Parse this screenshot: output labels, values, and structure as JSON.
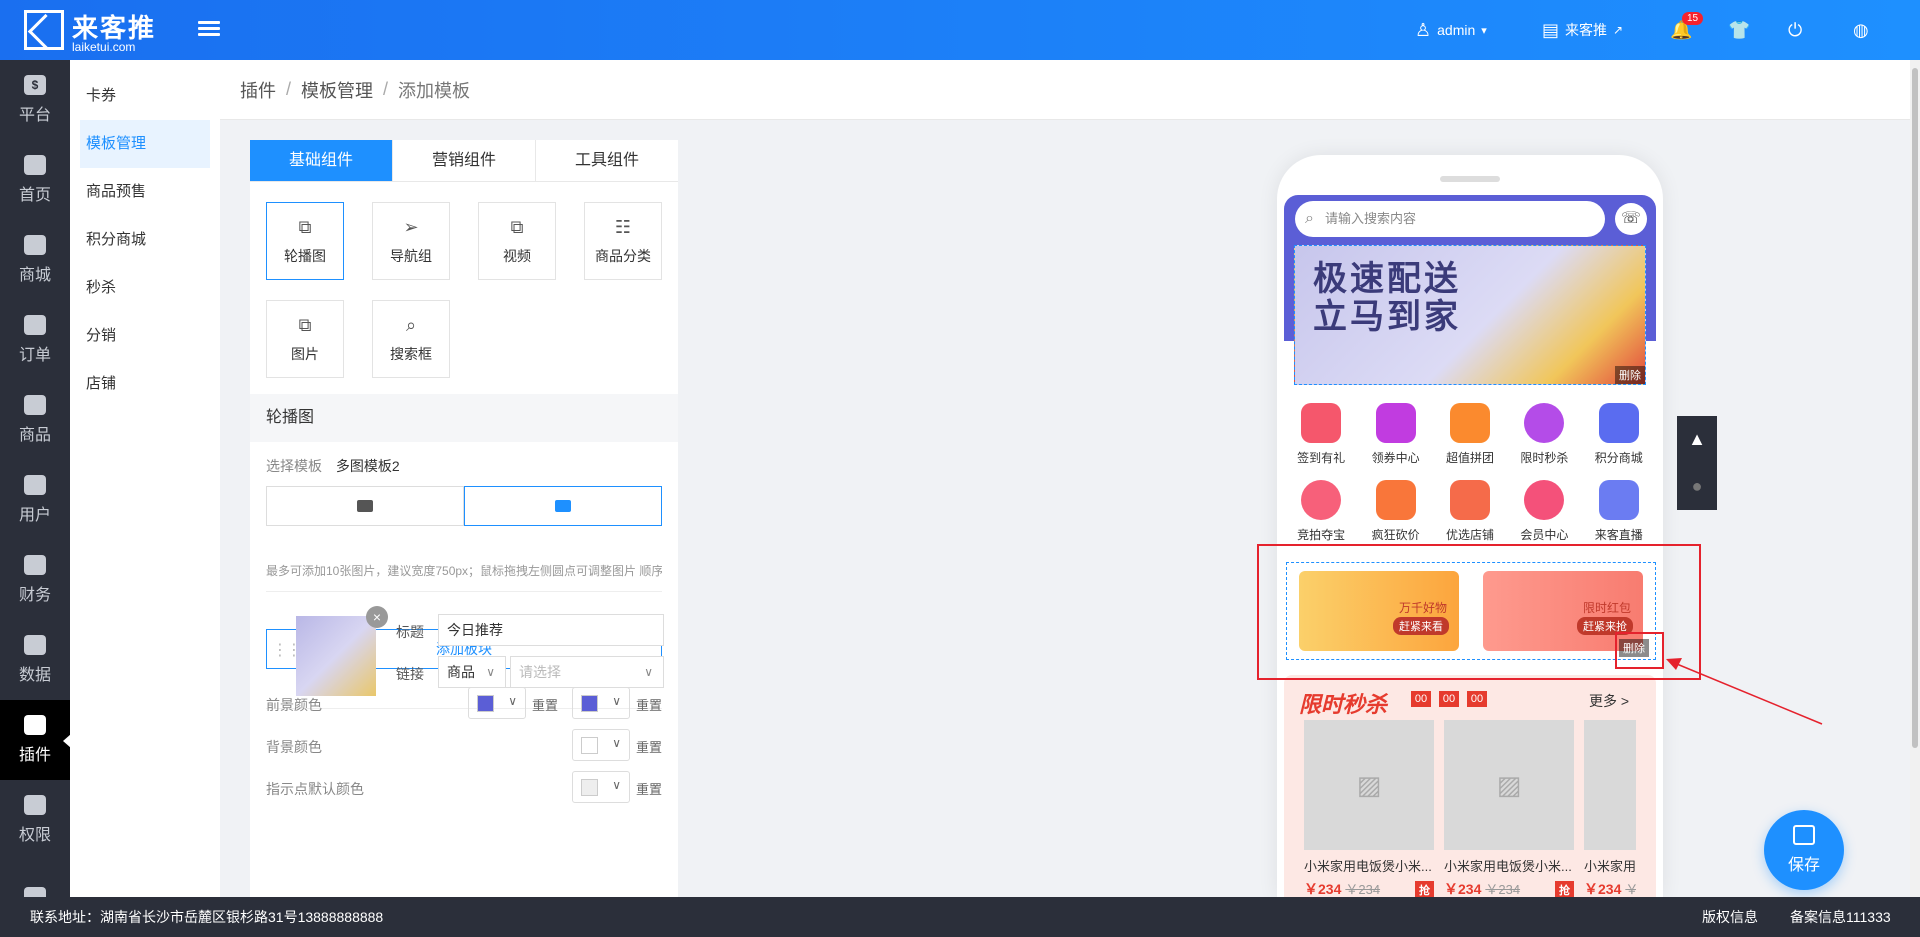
{
  "header": {
    "logo_cn": "来客推",
    "logo_en": "laiketui.com",
    "user": "admin",
    "shop": "来客推",
    "notifications": "15"
  },
  "nav": {
    "items": [
      {
        "label": "平台",
        "icon": "platform-icon"
      },
      {
        "label": "首页",
        "icon": "home-icon"
      },
      {
        "label": "商城",
        "icon": "mall-icon"
      },
      {
        "label": "订单",
        "icon": "order-icon"
      },
      {
        "label": "商品",
        "icon": "goods-icon"
      },
      {
        "label": "用户",
        "icon": "user-icon"
      },
      {
        "label": "财务",
        "icon": "wallet-icon"
      },
      {
        "label": "数据",
        "icon": "pie-chart-icon"
      },
      {
        "label": "插件",
        "icon": "puzzle-icon"
      },
      {
        "label": "权限",
        "icon": "shield-icon"
      },
      {
        "label": "",
        "icon": "image-icon"
      }
    ],
    "active_index": 8
  },
  "submenu": {
    "items": [
      "卡券",
      "模板管理",
      "商品预售",
      "积分商城",
      "秒杀",
      "分销",
      "店铺"
    ],
    "active_index": 1
  },
  "breadcrumb": [
    "插件",
    "模板管理",
    "添加模板"
  ],
  "panel": {
    "tabs": [
      "基础组件",
      "营销组件",
      "工具组件"
    ],
    "components": [
      "轮播图",
      "导航组",
      "视频",
      "商品分类",
      "图片",
      "搜索框"
    ],
    "section_title": "轮播图",
    "template_label": "选择模板",
    "template_value": "多图模板2",
    "hint": "最多可添加10张图片，建议宽度750px；鼠标拖拽左侧圆点可调整图片 顺序",
    "item": {
      "title_label": "标题",
      "title_value": "今日推荐",
      "link_label": "链接",
      "link_type": "商品",
      "link_placeholder": "请选择"
    },
    "add_block": "添加板块",
    "fg_color_label": "前景颜色",
    "bg_color_label": "背景颜色",
    "dot_color_label": "指示点默认颜色",
    "reset": "重置",
    "fg_color": "#5b5ed6"
  },
  "phone": {
    "search_placeholder": "请输入搜索内容",
    "banner_text1": "极速配送",
    "banner_text2": "立马到家",
    "delete": "删除",
    "icons_row1": [
      "签到有礼",
      "领券中心",
      "超值拼团",
      "限时秒杀",
      "积分商城"
    ],
    "icons_row2": [
      "竞拍夺宝",
      "疯狂砍价",
      "优选店铺",
      "会员中心",
      "来客直播"
    ],
    "promo": [
      {
        "title": "万千好物",
        "button": "赶紧来看"
      },
      {
        "title": "限时红包",
        "button": "赶紧来抢"
      }
    ],
    "flash_title": "限时秒杀",
    "countdown": [
      "00",
      "00",
      "00"
    ],
    "more": "更多 >",
    "products": [
      {
        "name": "小米家用电饭煲小米...",
        "price": "￥234",
        "old": "￥234",
        "tag": "抢"
      },
      {
        "name": "小米家用电饭煲小米...",
        "price": "￥234",
        "old": "￥234",
        "tag": "抢"
      },
      {
        "name": "小米家用",
        "price": "￥234",
        "old": "￥",
        "tag": ""
      }
    ]
  },
  "save": "保存",
  "footer": {
    "address": "联系地址：湖南省长沙市岳麓区银杉路31号13888888888",
    "copyright": "版权信息",
    "record": "备案信息111333"
  }
}
